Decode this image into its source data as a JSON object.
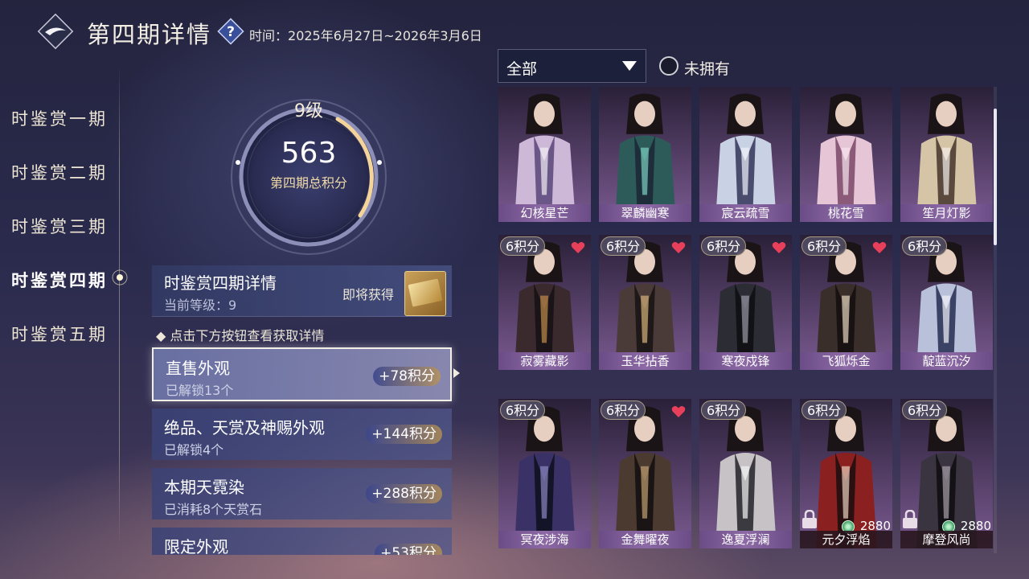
{
  "header": {
    "title": "第四期详情",
    "help_icon": "question-icon",
    "period_label": "时间：",
    "period_value": "2025年6月27日~2026年3月6日"
  },
  "sidebar": {
    "items": [
      {
        "label": "时鉴赏一期"
      },
      {
        "label": "时鉴赏二期"
      },
      {
        "label": "时鉴赏三期"
      },
      {
        "label": "时鉴赏四期",
        "active": true
      },
      {
        "label": "时鉴赏五期"
      }
    ]
  },
  "progress": {
    "level": "9级",
    "score": "563",
    "score_label": "第四期总积分"
  },
  "detail": {
    "title": "时鉴赏四期详情",
    "current_level": "当前等级：9",
    "soon_label": "即将获得",
    "hint": "◆ 点击下方按钮查看获取详情"
  },
  "categories": [
    {
      "title": "直售外观",
      "sub": "已解锁13个",
      "points": "+78积分",
      "active": true
    },
    {
      "title": "绝品、天赏及神赐外观",
      "sub": "已解锁4个",
      "points": "+144积分"
    },
    {
      "title": "本期天霓染",
      "sub": "已消耗8个天赏石",
      "points": "+288积分"
    },
    {
      "title": "限定外观",
      "sub": "",
      "points": "+53积分"
    }
  ],
  "filter": {
    "selected": "全部",
    "toggle_label": "未拥有"
  },
  "outfits": [
    {
      "name": "幻核星芒",
      "points": "",
      "favorite": false
    },
    {
      "name": "翠麟幽寒",
      "points": "",
      "favorite": false
    },
    {
      "name": "宸云疏雪",
      "points": "",
      "favorite": false
    },
    {
      "name": "桃花雪",
      "points": "",
      "favorite": false
    },
    {
      "name": "笙月灯影",
      "points": "",
      "favorite": false
    },
    {
      "name": "寂雾藏影",
      "points": "6积分",
      "favorite": true
    },
    {
      "name": "玉华拈香",
      "points": "6积分",
      "favorite": true
    },
    {
      "name": "寒夜戍锋",
      "points": "6积分",
      "favorite": true
    },
    {
      "name": "飞狐烁金",
      "points": "6积分",
      "favorite": true
    },
    {
      "name": "靛蓝沉汐",
      "points": "6积分",
      "favorite": false
    },
    {
      "name": "冥夜涉海",
      "points": "6积分",
      "favorite": false
    },
    {
      "name": "金舞曜夜",
      "points": "6积分",
      "favorite": true
    },
    {
      "name": "逸夏浮澜",
      "points": "6积分",
      "favorite": false
    },
    {
      "name": "元夕浮焰",
      "points": "6积分",
      "favorite": false,
      "locked": true,
      "price": "2880"
    },
    {
      "name": "摩登风尚",
      "points": "6积分",
      "favorite": false,
      "locked": true,
      "price": "2880"
    }
  ],
  "colors": {
    "name_bar": "#8d6aa6",
    "heart": "#e8405a",
    "accent_gold": "#f0d9a6"
  }
}
